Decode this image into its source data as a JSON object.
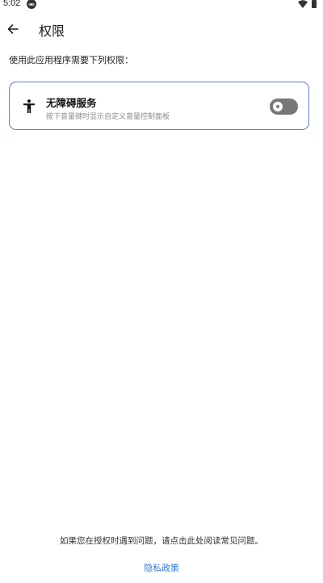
{
  "status_bar": {
    "time": "5:02",
    "app_icon": "game-controller-icon",
    "wifi_icon": "wifi-icon",
    "battery_icon": "battery-icon"
  },
  "app_bar": {
    "back_icon": "arrow-left-icon",
    "title": "权限"
  },
  "intro": "使用此应用程序需要下列权限：",
  "permission": {
    "icon": "accessibility-icon",
    "title": "无障碍服务",
    "description": "按下音量键时显示自定义音量控制面板",
    "enabled": false,
    "border_color": "#5b7fd6"
  },
  "footer": {
    "help_text": "如果您在授权时遇到问题，请点击此处阅读常见问题。",
    "privacy_link": "隐私政策",
    "link_color": "#2f7cd6"
  }
}
